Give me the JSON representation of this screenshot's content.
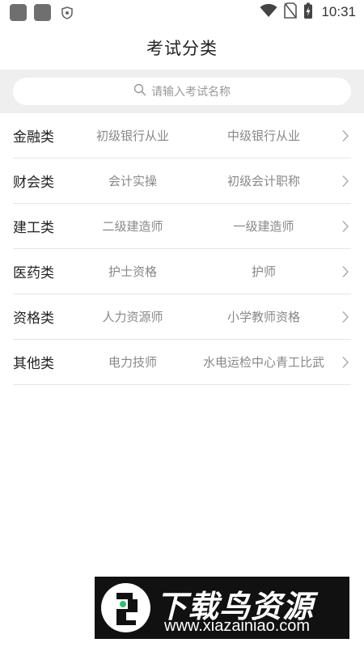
{
  "status_bar": {
    "time": "10:31",
    "icons": [
      "app-square-icon",
      "app-square-icon",
      "shield-icon",
      "wifi-icon",
      "no-sim-icon",
      "battery-charging-icon"
    ]
  },
  "header": {
    "title": "考试分类"
  },
  "search": {
    "placeholder": "请输入考试名称"
  },
  "categories": [
    {
      "name": "金融类",
      "exams": [
        "初级银行从业",
        "中级银行从业"
      ]
    },
    {
      "name": "财会类",
      "exams": [
        "会计实操",
        "初级会计职称"
      ]
    },
    {
      "name": "建工类",
      "exams": [
        "二级建造师",
        "一级建造师"
      ]
    },
    {
      "name": "医药类",
      "exams": [
        "护士资格",
        "护师"
      ]
    },
    {
      "name": "资格类",
      "exams": [
        "人力资源师",
        "小学教师资格"
      ]
    },
    {
      "name": "其他类",
      "exams": [
        "电力技师",
        "水电运检中心青工比武"
      ]
    }
  ],
  "watermark": {
    "title": "下载鸟资源",
    "url": "www.xiazainiao.com"
  },
  "colors": {
    "text_primary": "#222222",
    "text_secondary": "#888888",
    "search_bg": "#efefef",
    "divider": "#e6e6e6"
  }
}
